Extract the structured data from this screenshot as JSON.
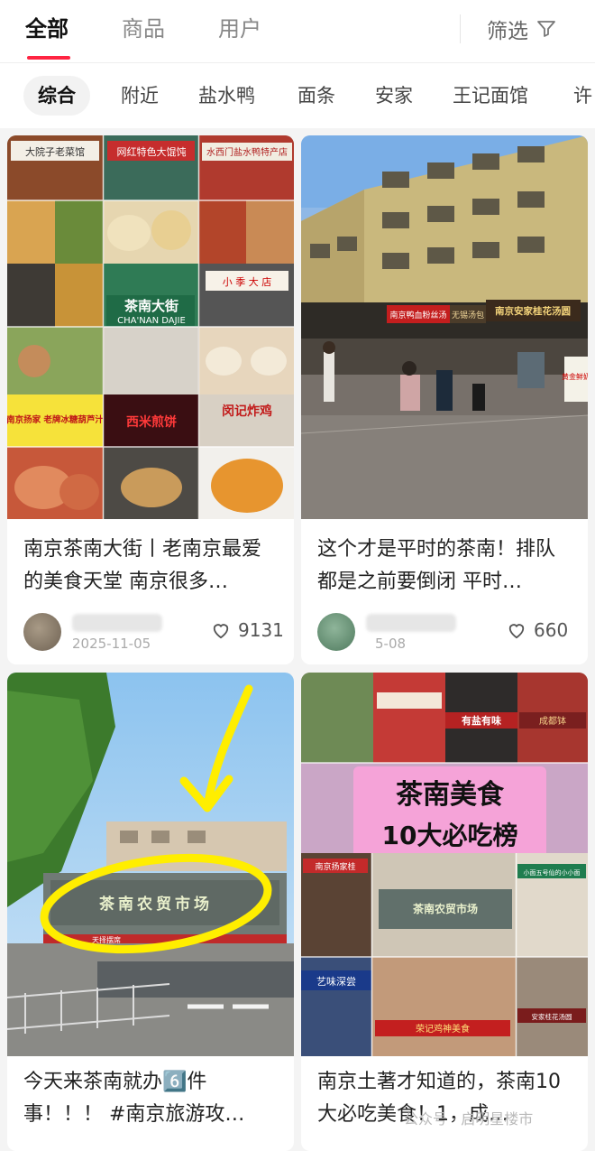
{
  "tabs": [
    {
      "label": "全部",
      "active": true
    },
    {
      "label": "商品",
      "active": false
    },
    {
      "label": "用户",
      "active": false
    }
  ],
  "filter": {
    "label": "筛选",
    "icon": "filter-funnel-icon"
  },
  "chips": [
    "综合",
    "附近",
    "盐水鸭",
    "面条",
    "安家",
    "王记面馆",
    "许"
  ],
  "cards": [
    {
      "title": "南京茶南大街丨老南京最爱的美食天堂 南京很多…",
      "likes": "9131",
      "date": "2025-11-05",
      "image_text": {
        "street_sign": "茶南大街",
        "street_pinyin": "CHA'NAN DAJIE",
        "shop_left": "南京扬家 老牌冰糖葫芦汁",
        "shop_mid": "西米煎饼",
        "shop_right": "闵记炸鸡",
        "top_left": "大院子老菜馆",
        "top_mid": "网红特色大馄饨",
        "top_right": "水西门盐水鸭特产店",
        "small_sign": "小 季 大 店"
      }
    },
    {
      "title": "这个才是平时的茶南！排队都是之前要倒闭 平时…",
      "likes": "660",
      "date": "5-08",
      "image_text": {
        "store_sign": "南京安家桂花汤圆",
        "store_sign2": "无锡汤包",
        "store_sign3": "南京鸭血粉丝汤",
        "side_sign": "黄金鲜奶"
      }
    },
    {
      "title": "今天来茶南就办6️⃣件事！！！ #南京旅游攻…",
      "image_text": {
        "market_sign": "茶南农贸市场",
        "lower_sign": "天择摆席"
      }
    },
    {
      "title": "南京土著才知道的，茶南10大必吃美食！1，成…",
      "image_text": {
        "overlay_line1": "茶南美食",
        "overlay_line2": "10大必吃榜",
        "market_sign": "茶南农贸市场",
        "shop_a": "南京扬家桂",
        "shop_b": "有盐有味",
        "shop_c": "成都钵",
        "shop_d": "艺味深尝",
        "shop_e": "小面五号仙的小小面",
        "shop_f": "荣记鸡神美食",
        "shop_g": "安家桂花汤圆"
      }
    }
  ],
  "watermark": "公众号 · 启明星楼市",
  "colors": {
    "accent": "#ff2442",
    "chip_bg": "#f2f2f2",
    "highlight_circle": "#ffee00",
    "overlay_pink": "#f5a3d8"
  }
}
